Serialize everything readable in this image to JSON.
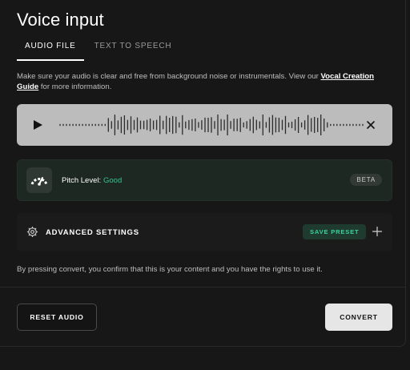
{
  "title": "Voice input",
  "tabs": [
    {
      "label": "AUDIO FILE",
      "active": true
    },
    {
      "label": "TEXT TO SPEECH",
      "active": false
    }
  ],
  "info": {
    "prefix": "Make sure your audio is clear and free from background noise or instrumentals. View our ",
    "link": "Vocal Creation Guide",
    "suffix": " for more information."
  },
  "pitch": {
    "label": "Pitch Level:",
    "value": "Good",
    "badge": "BETA"
  },
  "advanced": {
    "label": "ADVANCED SETTINGS",
    "save_preset": "SAVE PRESET"
  },
  "consent": "By pressing convert, you confirm that this is your content and you have the rights to use it.",
  "buttons": {
    "reset": "RESET AUDIO",
    "convert": "CONVERT"
  },
  "colors": {
    "accent_green": "#34c58b",
    "player_bg": "#bcbcbc",
    "pitch_card_bg": "#1d2823"
  },
  "icons": {
    "play": "play-icon",
    "close": "close-icon",
    "gauge": "gauge-icon",
    "gear": "gear-icon",
    "plus": "plus-icon"
  }
}
